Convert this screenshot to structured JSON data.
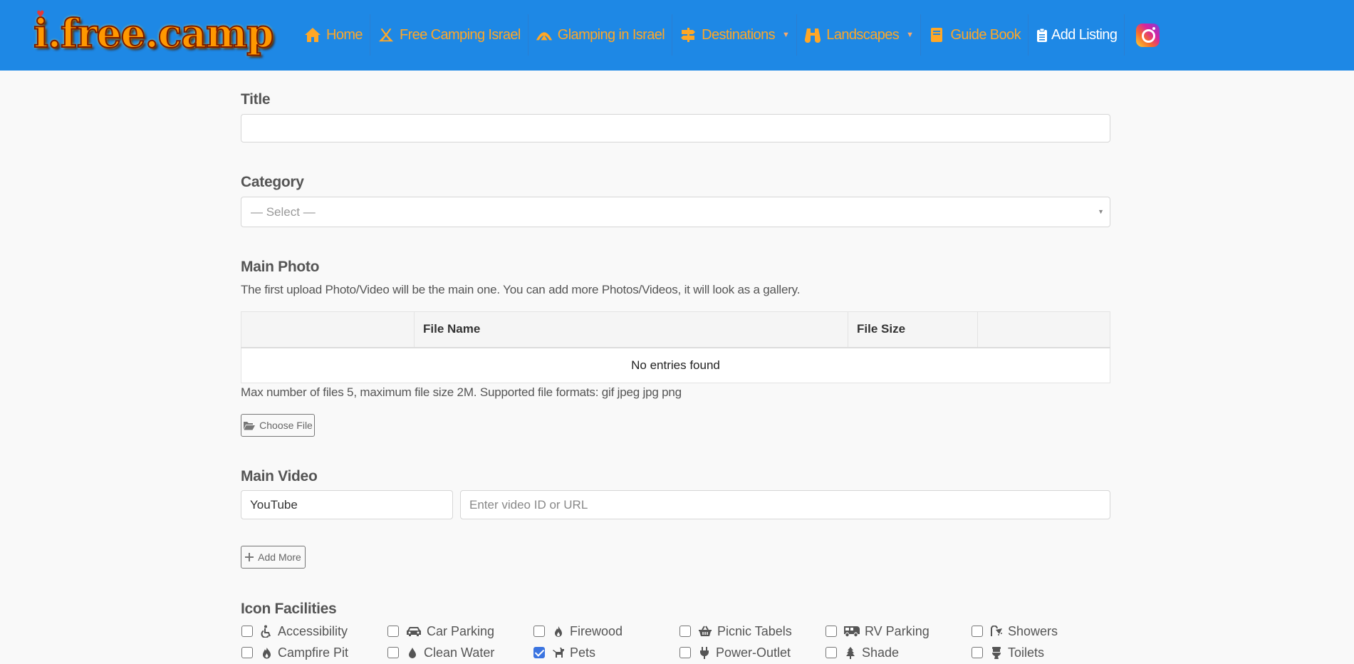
{
  "brand": {
    "logo_text": "i.free.camp"
  },
  "nav": {
    "items": [
      {
        "label": "Home",
        "icon": "home-icon"
      },
      {
        "label": "Free Camping Israel",
        "icon": "tent-icon"
      },
      {
        "label": "Glamping in Israel",
        "icon": "glamping-tent-icon"
      },
      {
        "label": "Destinations",
        "icon": "signpost-icon",
        "dropdown": true
      },
      {
        "label": "Landscapes",
        "icon": "binoculars-icon",
        "dropdown": true
      },
      {
        "label": "Guide Book",
        "icon": "book-icon"
      },
      {
        "label": "Add Listing",
        "icon": "clipboard-icon",
        "active": true
      },
      {
        "label": "",
        "icon": "instagram-icon"
      }
    ],
    "colors": {
      "bar": "#1e88e5",
      "link": "#ffa726",
      "active": "#ffffff"
    }
  },
  "form": {
    "title": {
      "label": "Title",
      "value": ""
    },
    "category": {
      "label": "Category",
      "selected": "— Select —"
    },
    "main_photo": {
      "label": "Main Photo",
      "help": "The first upload Photo/Video will be the main one. You can add more Photos/Videos, it will look as a gallery.",
      "table": {
        "columns": [
          "",
          "File Name",
          "File Size",
          ""
        ],
        "empty_text": "No entries found"
      },
      "limits_text": "Max number of files 5, maximum file size 2M. Supported file formats: gif jpeg jpg png",
      "choose_file_label": "Choose File"
    },
    "main_video": {
      "label": "Main Video",
      "provider": "YouTube",
      "placeholder": "Enter video ID or URL",
      "add_more_label": "Add More"
    },
    "facilities": {
      "label": "Icon Facilities",
      "items": [
        {
          "label": "Accessibility",
          "icon": "wheelchair-icon",
          "checked": false
        },
        {
          "label": "Car Parking",
          "icon": "car-icon",
          "checked": false
        },
        {
          "label": "Firewood",
          "icon": "fire-icon",
          "checked": false
        },
        {
          "label": "Picnic Tabels",
          "icon": "basket-icon",
          "checked": false
        },
        {
          "label": "RV Parking",
          "icon": "rv-icon",
          "checked": false
        },
        {
          "label": "Showers",
          "icon": "shower-icon",
          "checked": false
        },
        {
          "label": "Campfire Pit",
          "icon": "flame-icon",
          "checked": false
        },
        {
          "label": "Clean Water",
          "icon": "droplet-icon",
          "checked": false
        },
        {
          "label": "Pets",
          "icon": "dog-icon",
          "checked": true
        },
        {
          "label": "Power-Outlet",
          "icon": "plug-icon",
          "checked": false
        },
        {
          "label": "Shade",
          "icon": "tree-icon",
          "checked": false
        },
        {
          "label": "Toilets",
          "icon": "toilet-icon",
          "checked": false
        }
      ]
    }
  }
}
